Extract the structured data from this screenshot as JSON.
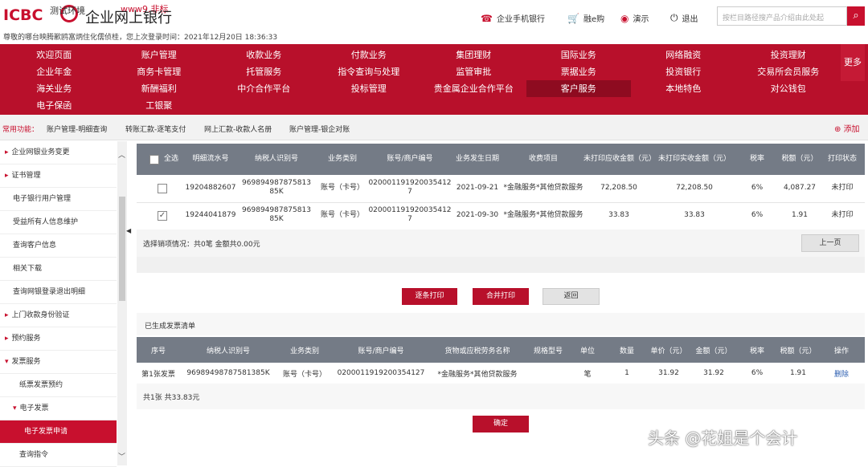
{
  "header": {
    "logo_text": "ICBC",
    "bank_name": "企业网上银行",
    "overlay_text": "测试环境",
    "overlay_red": "www9.非标",
    "welcome": "尊敬的哪台映腾歉鸥富炳住化儒侦桂，您上次登录时间：2021年12月20日 18:36:33",
    "links": [
      {
        "label": "企业手机银行",
        "icon": "mobile-icon"
      },
      {
        "label": "融e购",
        "icon": "cart-icon"
      },
      {
        "label": "演示",
        "icon": "eye-icon"
      },
      {
        "label": "退出",
        "icon": "power-icon"
      }
    ],
    "search_placeholder": "按栏目路径搜产品介绍由此处起"
  },
  "nav": {
    "rows": [
      [
        "欢迎页面",
        "账户管理",
        "收款业务",
        "付款业务",
        "集团理财",
        "国际业务",
        "网络融资",
        "投资理财"
      ],
      [
        "企业年金",
        "商务卡管理",
        "托管服务",
        "指令查询与处理",
        "监管审批",
        "票据业务",
        "投资银行",
        "交易所会员服务"
      ],
      [
        "海关业务",
        "新酬福利",
        "中介合作平台",
        "投标管理",
        "贵金属企业合作平台",
        "客户服务",
        "本地特色",
        "对公钱包"
      ],
      [
        "电子保函",
        "工银聚"
      ]
    ],
    "more": "更多"
  },
  "common": {
    "label": "常用功能：",
    "links": [
      "账户管理-明细查询",
      "转账汇款-逐笔支付",
      "网上汇款-收款人名册",
      "账户管理-银企对账"
    ],
    "add": "添加"
  },
  "sidebar": {
    "items": [
      {
        "label": "企业网银业务变更",
        "type": "group"
      },
      {
        "label": "证书管理",
        "type": "group"
      },
      {
        "label": "电子银行用户管理",
        "type": "sub2"
      },
      {
        "label": "受益所有人信息维护",
        "type": "sub2"
      },
      {
        "label": "查询客户信息",
        "type": "sub2"
      },
      {
        "label": "相关下载",
        "type": "sub2"
      },
      {
        "label": "查询网银登录退出明细",
        "type": "sub2"
      },
      {
        "label": "上门收款身份验证",
        "type": "group"
      },
      {
        "label": "预约服务",
        "type": "group"
      },
      {
        "label": "发票服务",
        "type": "group open"
      },
      {
        "label": "纸票发票预约",
        "type": "sub"
      },
      {
        "label": "电子发票",
        "type": "sub2 open"
      },
      {
        "label": "电子发票申请",
        "type": "active"
      },
      {
        "label": "查询指令",
        "type": "sub"
      }
    ]
  },
  "table1": {
    "headers": [
      "全选",
      "明细流水号",
      "纳税人识别号",
      "业务类别",
      "账号/商户编号",
      "业务发生日期",
      "收费项目",
      "未打印应收金额（元）",
      "未打印实收金额（元）",
      "税率",
      "税额（元）",
      "打印状态"
    ],
    "rows": [
      {
        "checked": false,
        "serial": "19204882607",
        "taxid": "969894987875813 85K",
        "type": "账号（卡号）",
        "account": "020001191920035412 7",
        "date": "2021-09-21",
        "item": "*金融服务*其他贷款服务",
        "due": "72,208.50",
        "paid": "72,208.50",
        "rate": "6%",
        "tax": "4,087.27",
        "status": "未打印"
      },
      {
        "checked": true,
        "serial": "19244041879",
        "taxid": "969894987875813 85K",
        "type": "账号（卡号）",
        "account": "020001191920035412 7",
        "date": "2021-09-30",
        "item": "*金融服务*其他贷款服务",
        "due": "33.83",
        "paid": "33.83",
        "rate": "6%",
        "tax": "1.91",
        "status": "未打印"
      }
    ],
    "summary": "选择销项情况：共0笔 金额共0.00元",
    "prev": "上一页"
  },
  "actions": {
    "print_each": "逐条打印",
    "merge_print": "合并打印",
    "back": "返回"
  },
  "invoice": {
    "title": "已生成发票清单",
    "headers": [
      "序号",
      "纳税人识别号",
      "业务类别",
      "账号/商户编号",
      "货物或应税劳务名称",
      "规格型号",
      "单位",
      "数量",
      "单价（元）",
      "金额（元）",
      "税率",
      "税额（元）",
      "操作"
    ],
    "row": {
      "no": "第1张发票",
      "taxid": "96989498787581385K",
      "type": "账号（卡号）",
      "account": "0200011919200354127",
      "name": "*金融服务*其他贷款服务",
      "spec": "",
      "unit": "笔",
      "qty": "1",
      "price": "31.92",
      "amount": "31.92",
      "rate": "6%",
      "tax": "1.91",
      "op": "删除"
    },
    "summary": "共1张 共33.83元",
    "confirm": "确定"
  },
  "watermark": "头条 @花姐是个会计"
}
